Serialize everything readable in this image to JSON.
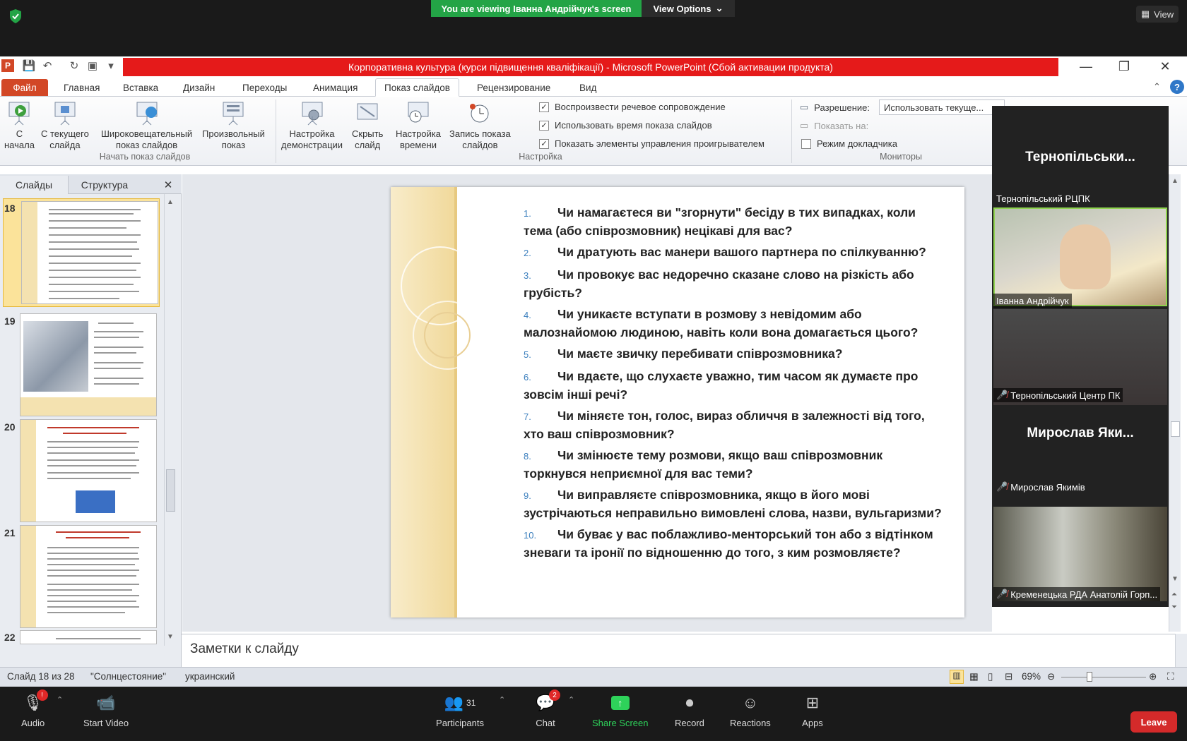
{
  "zoom": {
    "share_banner": "You are viewing Іванна Андрійчук's screen",
    "view_options": "View Options",
    "view": "View",
    "bottom": {
      "audio": "Audio",
      "video": "Start Video",
      "participants": "Participants",
      "participants_count": "31",
      "chat": "Chat",
      "chat_badge": "2",
      "share": "Share Screen",
      "record": "Record",
      "reactions": "Reactions",
      "apps": "Apps",
      "leave": "Leave",
      "audio_badge": "!"
    }
  },
  "ppt": {
    "title": "Корпоративна культура (курси підвищення кваліфікації)  -  Microsoft PowerPoint (Сбой активации продукта)",
    "tabs": [
      "Файл",
      "Главная",
      "Вставка",
      "Дизайн",
      "Переходы",
      "Анимация",
      "Показ слайдов",
      "Рецензирование",
      "Вид"
    ],
    "ribbon": {
      "from_start": [
        "С",
        "начала"
      ],
      "from_current": [
        "С текущего",
        "слайда"
      ],
      "broadcast": [
        "Широковещательный",
        "показ слайдов"
      ],
      "custom": [
        "Произвольный",
        "показ"
      ],
      "group_start": "Начать показ слайдов",
      "setup": [
        "Настройка",
        "демонстрации"
      ],
      "hide": [
        "Скрыть",
        "слайд"
      ],
      "rehearse": [
        "Настройка",
        "времени"
      ],
      "record": [
        "Запись показа",
        "слайдов"
      ],
      "chk_narration": "Воспроизвести речевое сопровождение",
      "chk_timings": "Использовать время показа слайдов",
      "chk_controls": "Показать элементы управления проигрывателем",
      "group_setup": "Настройка",
      "resolution_label": "Разрешение:",
      "resolution_value": "Использовать текуще...",
      "show_on": "Показать на:",
      "presenter": "Режим докладчика",
      "group_monitors": "Мониторы"
    },
    "pane_tabs": {
      "slides": "Слайды",
      "outline": "Структура"
    },
    "thumbs": [
      "18",
      "19",
      "20",
      "21",
      "22"
    ],
    "questions": [
      {
        "n": "1.",
        "t": "Чи намагаєтеся ви \"згорнути\" бесіду в тих випадках, коли тема (або співрозмовник) нецікаві для вас?"
      },
      {
        "n": "2.",
        "t": "Чи дратують вас манери вашого партнера по спілкуванню?"
      },
      {
        "n": "3.",
        "t": "Чи провокує вас недоречно сказане слово на різкість або грубість?"
      },
      {
        "n": "4.",
        "t": "Чи уникаєте вступати в розмову з невідомим або малознайомою людиною, навіть коли вона домагається цього?"
      },
      {
        "n": "5.",
        "t": "Чи маєте звичку перебивати співрозмовника?"
      },
      {
        "n": "6.",
        "t": "Чи вдаєте, що слухаєте уважно, тим часом як думаєте про зовсім інші речі?"
      },
      {
        "n": "7.",
        "t": "Чи міняєте тон, голос, вираз обличчя в залежності від того, хто ваш співрозмовник?"
      },
      {
        "n": "8.",
        "t": "Чи змінюєте тему розмови, якщо ваш співрозмовник торкнувся неприємної для вас теми?"
      },
      {
        "n": "9.",
        "t": "Чи виправляєте співрозмовника, якщо в його мові зустрічаються неправильно вимовлені слова, назви, вульгаризми?"
      },
      {
        "n": "10.",
        "t": "Чи буває у вас поблажливо-менторський тон або з відтінком зневаги та іронії по відношенню до того, з ким розмовляєте?"
      }
    ],
    "notes_placeholder": "Заметки к слайду",
    "status": {
      "slide": "Слайд 18 из 28",
      "theme": "\"Солнцестояние\"",
      "lang": "украинский",
      "zoom": "69%"
    }
  },
  "participants": {
    "tile1_big": "Тернопільськи...",
    "tile1_small": "Тернопільський РЦПК",
    "tile2": "Іванна Андрійчук",
    "tile3": "Тернопільський Центр ПК",
    "tile4_big": "Мирослав Яки...",
    "tile4_small": "Мирослав Якимів",
    "tile5": "Кременецька РДА Анатолій Горп..."
  }
}
